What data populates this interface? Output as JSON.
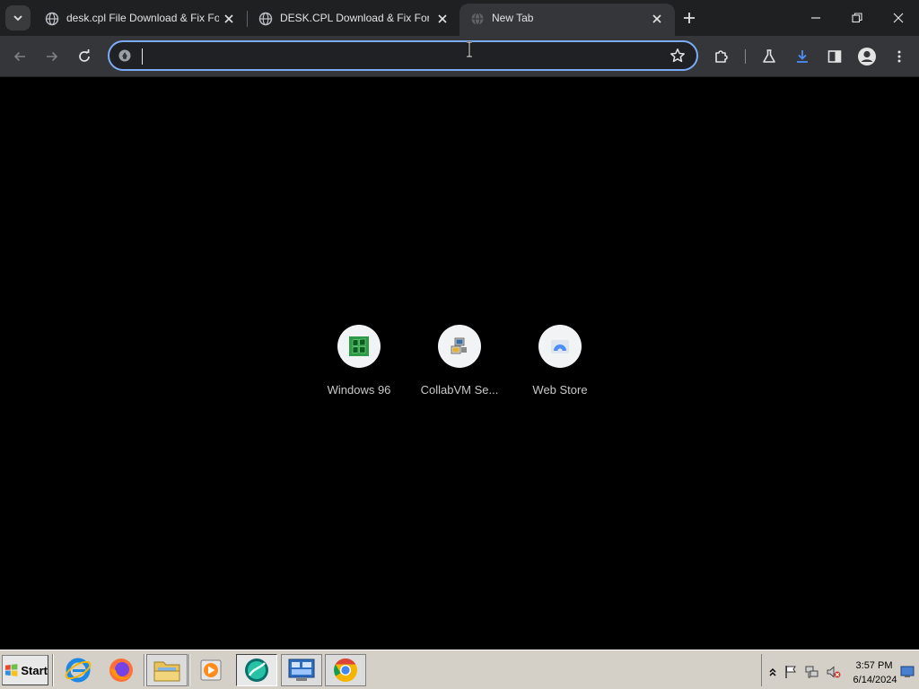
{
  "browser": {
    "tabs": [
      {
        "title": "desk.cpl File Download & Fix For A",
        "active": false,
        "favicon": "globe-icon"
      },
      {
        "title": "DESK.CPL Download & Fix For Wi",
        "active": false,
        "favicon": "globe-icon"
      },
      {
        "title": "New Tab",
        "active": true,
        "favicon": "globe-icon"
      }
    ],
    "omnibox": {
      "value": "",
      "placeholder": ""
    },
    "colors": {
      "tabstrip": "#1f2021",
      "toolbar": "#35363a",
      "omnibox_focus_ring": "#7cacf8",
      "download_accent": "#4c8df6",
      "page_background": "#000000"
    }
  },
  "new_tab_page": {
    "shortcuts": [
      {
        "label": "Windows 96",
        "icon": "windows96-logo-icon"
      },
      {
        "label": "CollabVM Se...",
        "icon": "collabvm-computer-icon"
      },
      {
        "label": "Web Store",
        "icon": "web-store-icon"
      }
    ]
  },
  "taskbar": {
    "start_label": "Start",
    "apps": [
      {
        "name": "Internet Explorer",
        "icon": "internet-explorer-icon"
      },
      {
        "name": "Firefox",
        "icon": "firefox-icon"
      },
      {
        "name": "File Explorer",
        "icon": "folder-icon"
      },
      {
        "name": "Media Player",
        "icon": "media-player-icon"
      },
      {
        "name": "Browser",
        "icon": "browser-app-icon"
      },
      {
        "name": "Control Panel",
        "icon": "control-panel-icon"
      },
      {
        "name": "Chrome",
        "icon": "chrome-icon"
      }
    ],
    "clock": {
      "time": "3:57 PM",
      "date": "6/14/2024"
    }
  }
}
